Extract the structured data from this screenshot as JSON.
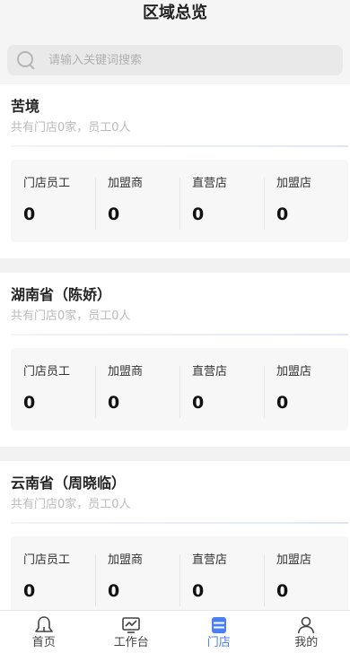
{
  "header": {
    "title": "区域总览"
  },
  "search": {
    "placeholder": "请输入关键词搜索"
  },
  "regions": [
    {
      "name": "苦境",
      "summary": "共有门店0家，员工0人",
      "stats": [
        {
          "label": "门店员工",
          "value": "0"
        },
        {
          "label": "加盟商",
          "value": "0"
        },
        {
          "label": "直营店",
          "value": "0"
        },
        {
          "label": "加盟店",
          "value": "0"
        }
      ]
    },
    {
      "name": "湖南省（陈娇）",
      "summary": "共有门店0家，员工0人",
      "stats": [
        {
          "label": "门店员工",
          "value": "0"
        },
        {
          "label": "加盟商",
          "value": "0"
        },
        {
          "label": "直营店",
          "value": "0"
        },
        {
          "label": "加盟店",
          "value": "0"
        }
      ]
    },
    {
      "name": "云南省（周晓临）",
      "summary": "共有门店0家，员工0人",
      "stats": [
        {
          "label": "门店员工",
          "value": "0"
        },
        {
          "label": "加盟商",
          "value": "0"
        },
        {
          "label": "直营店",
          "value": "0"
        },
        {
          "label": "加盟店",
          "value": "0"
        }
      ]
    }
  ],
  "tabbar": {
    "active_color": "#4a7ef3",
    "items": [
      {
        "label": "首页",
        "icon": "home-icon"
      },
      {
        "label": "工作台",
        "icon": "workbench-icon"
      },
      {
        "label": "门店",
        "icon": "store-icon",
        "active": true
      },
      {
        "label": "我的",
        "icon": "profile-icon"
      }
    ]
  }
}
